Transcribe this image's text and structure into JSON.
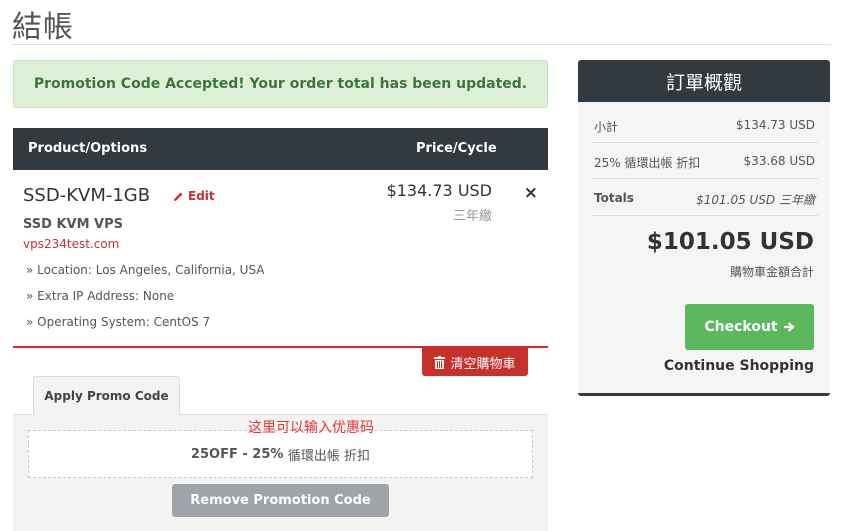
{
  "page_title": "結帳",
  "alert": {
    "message": "Promotion Code Accepted! Your order total has been updated."
  },
  "cart": {
    "header": {
      "product": "Product/Options",
      "price": "Price/Cycle"
    },
    "item": {
      "name": "SSD-KVM-1GB",
      "edit_label": "Edit",
      "group": "SSD KVM VPS",
      "domain": "vps234test.com",
      "options": [
        "» Location: Los Angeles, California, USA",
        "» Extra IP Address: None",
        "» Operating System: CentOS 7"
      ],
      "price": "$134.73 USD",
      "cycle": "三年繳",
      "remove_symbol": "×"
    },
    "empty_cart_label": "清空購物車"
  },
  "promo": {
    "tab_label": "Apply Promo Code",
    "note": "这里可以输入优惠码",
    "code_prefix": "25OFF - 25%",
    "code_suffix": "循環出帳 折扣",
    "remove_label": "Remove Promotion Code"
  },
  "summary": {
    "title": "訂單概觀",
    "subtotal_label": "小計",
    "subtotal_value": "$134.73 USD",
    "discount_label": "25% 循環出帳 折扣",
    "discount_value": "$33.68 USD",
    "totals_label": "Totals",
    "totals_value": "$101.05 USD 三年繳",
    "grand_total": "$101.05 USD",
    "grand_total_label": "購物車金額合計",
    "checkout_label": "Checkout",
    "continue_label": "Continue Shopping"
  },
  "colors": {
    "dark_header": "#333a3f",
    "danger": "#c9302c",
    "success": "#5cb85c",
    "alert_bg": "#dff0d8",
    "alert_text": "#3c763d",
    "annotation": "#e53935"
  },
  "icons": {
    "edit": "pencil-icon",
    "remove": "close-icon",
    "empty_cart": "trash-icon",
    "checkout": "arrow-right-icon"
  }
}
